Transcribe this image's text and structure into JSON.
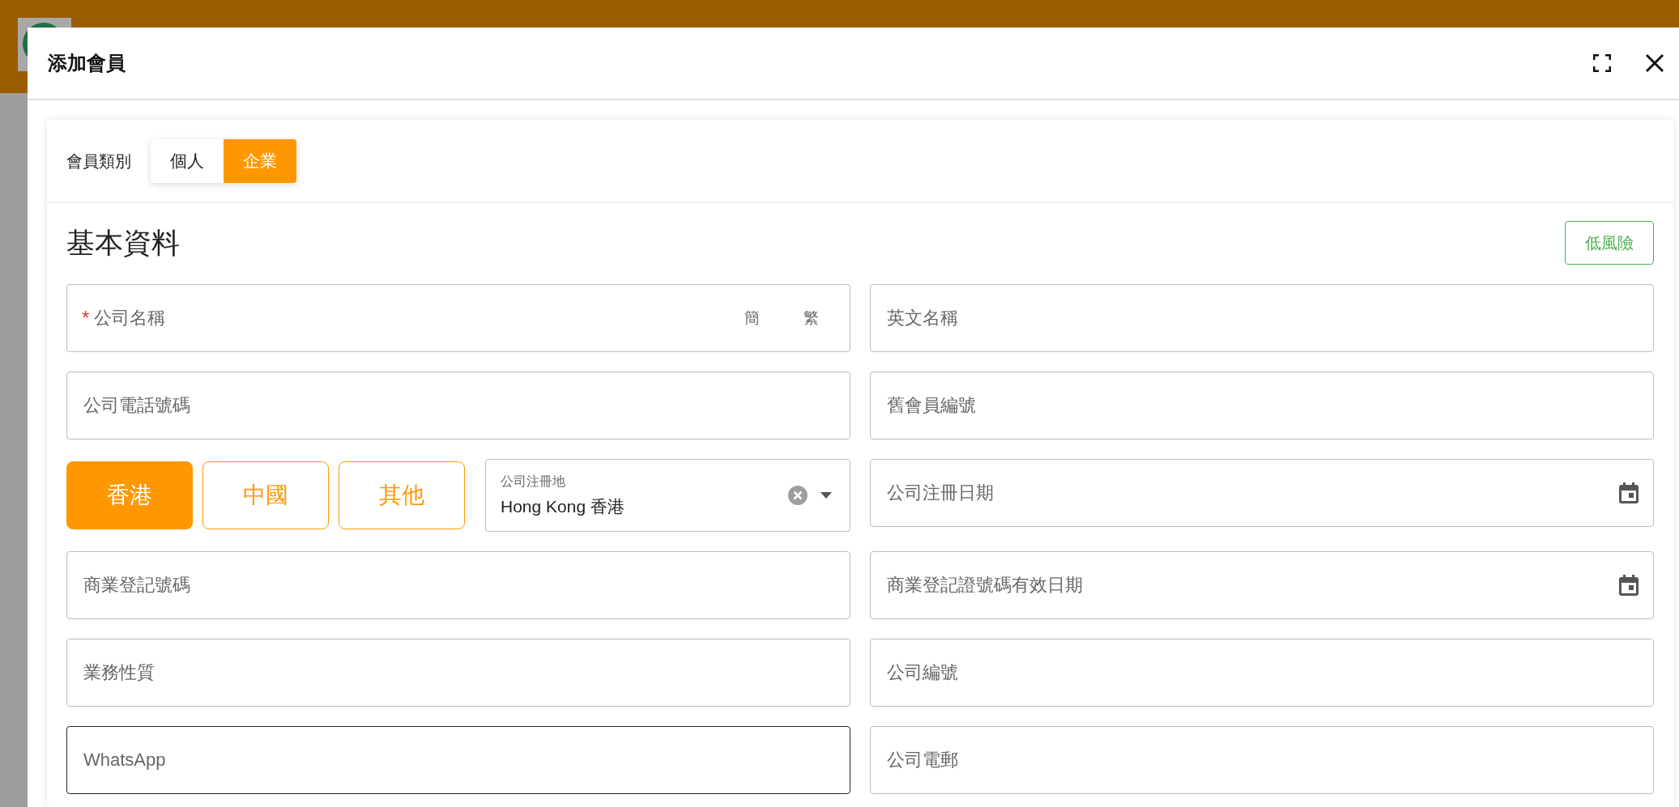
{
  "dialog": {
    "title": "添加會員"
  },
  "member_type": {
    "label": "會員類別",
    "options": [
      {
        "label": "個人",
        "selected": false
      },
      {
        "label": "企業",
        "selected": true
      }
    ]
  },
  "section": {
    "title": "基本資料",
    "risk_badge": "低風險"
  },
  "fields": [
    {
      "kind": "text",
      "placeholder": "公司名稱",
      "required_mark": "*",
      "script_options": [
        "簡",
        "繁"
      ],
      "focused": false
    },
    {
      "kind": "text",
      "placeholder": "英文名稱",
      "focused": false
    },
    {
      "kind": "text",
      "placeholder": "公司電話號碼",
      "focused": false
    },
    {
      "kind": "text",
      "placeholder": "舊會員編號",
      "focused": false
    },
    {
      "kind": "region",
      "regions": [
        {
          "label": "香港",
          "selected": true
        },
        {
          "label": "中國",
          "selected": false
        },
        {
          "label": "其他",
          "selected": false
        }
      ],
      "select": {
        "label": "公司注冊地",
        "value": "Hong Kong 香港"
      }
    },
    {
      "kind": "date",
      "placeholder": "公司注冊日期",
      "focused": false
    },
    {
      "kind": "text",
      "placeholder": "商業登記號碼",
      "focused": false
    },
    {
      "kind": "date",
      "placeholder": "商業登記證號碼有效日期",
      "focused": false
    },
    {
      "kind": "text",
      "placeholder": "業務性質",
      "focused": false
    },
    {
      "kind": "text",
      "placeholder": "公司編號",
      "focused": false
    },
    {
      "kind": "text",
      "placeholder": "WhatsApp",
      "focused": true
    },
    {
      "kind": "text",
      "placeholder": "公司電郵",
      "focused": false
    }
  ]
}
